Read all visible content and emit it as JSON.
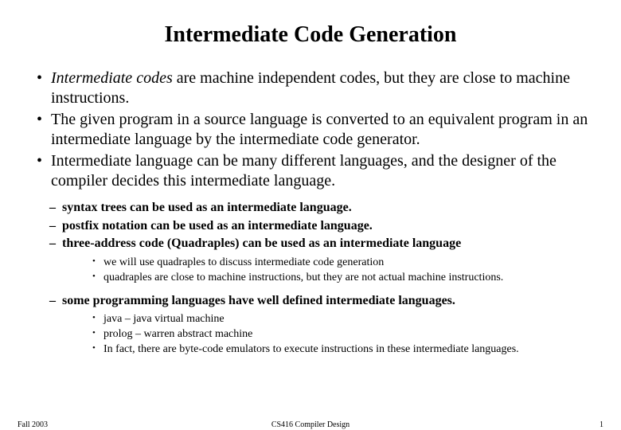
{
  "title": "Intermediate Code Generation",
  "bullets": {
    "b1_italic": "Intermediate codes",
    "b1_rest": " are machine independent codes, but they are close to machine instructions.",
    "b2": "The given program in a source language is converted to an    equivalent program in an intermediate language by the intermediate code generator.",
    "b3": "Intermediate language can be many different languages, and the designer of the compiler decides this intermediate language."
  },
  "dash": {
    "d1": "syntax trees can be used as an intermediate language.",
    "d2": "postfix notation can be used as an intermediate language.",
    "d3": "three-address code (Quadraples) can be used as an intermediate language",
    "d4": "some programming languages have well defined intermediate languages."
  },
  "dot1": {
    "a": "we will use quadraples to discuss intermediate code generation",
    "b": "quadraples are close to machine instructions, but they are not actual machine instructions."
  },
  "dot2": {
    "a": "java – java virtual machine",
    "b": "prolog – warren abstract machine",
    "c": "In fact, there are byte-code emulators to execute instructions in these intermediate languages."
  },
  "footer": {
    "left": "Fall 2003",
    "center": "CS416 Compiler Design",
    "right": "1"
  }
}
